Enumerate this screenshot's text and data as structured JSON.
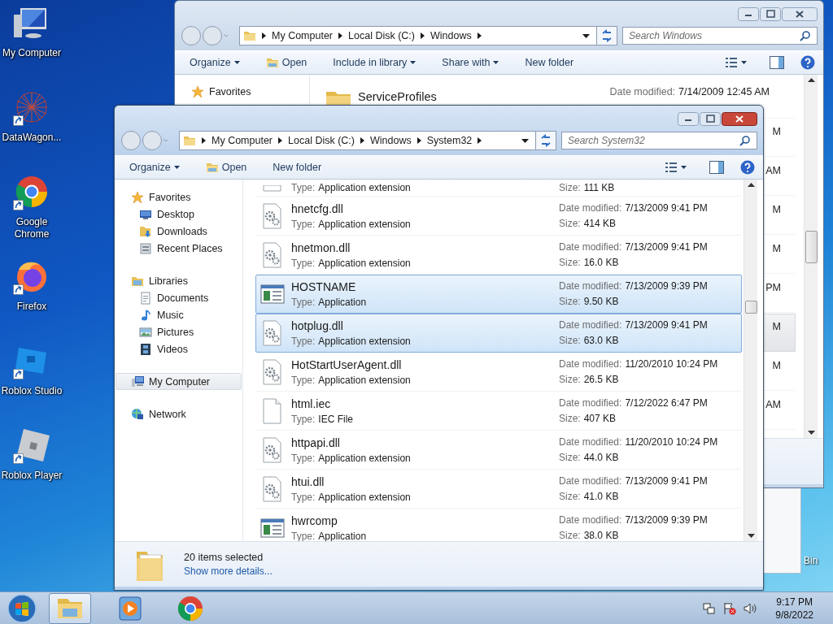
{
  "desktop_icons": [
    {
      "label": "My Computer",
      "kind": "computer",
      "shortcut": false
    },
    {
      "label": "DataWagon...",
      "kind": "web",
      "shortcut": true
    },
    {
      "label": "Google Chrome",
      "kind": "chrome",
      "shortcut": true
    },
    {
      "label": "Firefox",
      "kind": "firefox",
      "shortcut": true
    },
    {
      "label": "Roblox Studio",
      "kind": "studio",
      "shortcut": true
    },
    {
      "label": "Roblox Player",
      "kind": "player",
      "shortcut": true
    }
  ],
  "recycle_bin_label": "Bin",
  "back_window": {
    "address": [
      "My Computer",
      "Local Disk (C:)",
      "Windows"
    ],
    "search": {
      "placeholder": "Search Windows"
    },
    "toolbar": [
      {
        "label": "Organize",
        "kind": "menu"
      },
      {
        "label": "Open",
        "kind": "open"
      },
      {
        "label": "Include in library",
        "kind": "menu"
      },
      {
        "label": "Share with",
        "kind": "menu"
      },
      {
        "label": "New folder",
        "kind": "plain"
      }
    ],
    "sidebar": [
      {
        "label": "Favorites",
        "kind": "star"
      }
    ],
    "first_row": {
      "name": "ServiceProfiles",
      "date_label": "Date modified:",
      "date": "7/14/2009 12:45 AM"
    },
    "row_tails": [
      {
        "text": "M",
        "selected": false
      },
      {
        "text": "AM",
        "selected": false
      },
      {
        "text": "M",
        "selected": false
      },
      {
        "text": "M",
        "selected": false
      },
      {
        "text": "PM",
        "selected": false
      },
      {
        "text": "M",
        "selected": true
      },
      {
        "text": "M",
        "selected": false
      },
      {
        "text": "AM",
        "selected": false
      }
    ]
  },
  "front_window": {
    "address": [
      "My Computer",
      "Local Disk (C:)",
      "Windows",
      "System32"
    ],
    "search": {
      "placeholder": "Search System32"
    },
    "toolbar": [
      {
        "label": "Organize",
        "kind": "menu"
      },
      {
        "label": "Open",
        "kind": "open"
      },
      {
        "label": "New folder",
        "kind": "plain"
      }
    ],
    "sidebar": [
      {
        "label": "Favorites",
        "kind": "star",
        "selected": false,
        "children": [
          {
            "label": "Desktop",
            "kind": "desktop",
            "selected": false
          },
          {
            "label": "Downloads",
            "kind": "downloads",
            "selected": false
          },
          {
            "label": "Recent Places",
            "kind": "recent",
            "selected": false
          }
        ]
      },
      {
        "label": "Libraries",
        "kind": "libraries",
        "selected": false,
        "children": [
          {
            "label": "Documents",
            "kind": "documents",
            "selected": false
          },
          {
            "label": "Music",
            "kind": "music",
            "selected": false
          },
          {
            "label": "Pictures",
            "kind": "pictures",
            "selected": false
          },
          {
            "label": "Videos",
            "kind": "videos",
            "selected": false
          }
        ]
      },
      {
        "label": "My Computer",
        "kind": "computer",
        "selected": true
      },
      {
        "label": "Network",
        "kind": "network",
        "selected": false
      }
    ],
    "partial_row": {
      "type_label": "Type:",
      "type": "Application extension",
      "size_label": "Size:",
      "size": "111 KB"
    },
    "rows": [
      {
        "name": "hnetcfg.dll",
        "kind": "dll",
        "type_label": "Type:",
        "type": "Application extension",
        "date_label": "Date modified:",
        "date": "7/13/2009 9:41 PM",
        "size_label": "Size:",
        "size": "414 KB",
        "selected": false
      },
      {
        "name": "hnetmon.dll",
        "kind": "dll",
        "type_label": "Type:",
        "type": "Application extension",
        "date_label": "Date modified:",
        "date": "7/13/2009 9:41 PM",
        "size_label": "Size:",
        "size": "16.0 KB",
        "selected": false
      },
      {
        "name": "HOSTNAME",
        "kind": "app",
        "type_label": "Type:",
        "type": "Application",
        "date_label": "Date modified:",
        "date": "7/13/2009 9:39 PM",
        "size_label": "Size:",
        "size": "9.50 KB",
        "selected": true
      },
      {
        "name": "hotplug.dll",
        "kind": "dll",
        "type_label": "Type:",
        "type": "Application extension",
        "date_label": "Date modified:",
        "date": "7/13/2009 9:41 PM",
        "size_label": "Size:",
        "size": "63.0 KB",
        "selected": true
      },
      {
        "name": "HotStartUserAgent.dll",
        "kind": "dll",
        "type_label": "Type:",
        "type": "Application extension",
        "date_label": "Date modified:",
        "date": "11/20/2010 10:24 PM",
        "size_label": "Size:",
        "size": "26.5 KB",
        "selected": false
      },
      {
        "name": "html.iec",
        "kind": "file",
        "type_label": "Type:",
        "type": "IEC File",
        "date_label": "Date modified:",
        "date": "7/12/2022 6:47 PM",
        "size_label": "Size:",
        "size": "407 KB",
        "selected": false
      },
      {
        "name": "httpapi.dll",
        "kind": "dll",
        "type_label": "Type:",
        "type": "Application extension",
        "date_label": "Date modified:",
        "date": "11/20/2010 10:24 PM",
        "size_label": "Size:",
        "size": "44.0 KB",
        "selected": false
      },
      {
        "name": "htui.dll",
        "kind": "dll",
        "type_label": "Type:",
        "type": "Application extension",
        "date_label": "Date modified:",
        "date": "7/13/2009 9:41 PM",
        "size_label": "Size:",
        "size": "41.0 KB",
        "selected": false
      },
      {
        "name": "hwrcomp",
        "kind": "app",
        "type_label": "Type:",
        "type": "Application",
        "date_label": "Date modified:",
        "date": "7/13/2009 9:39 PM",
        "size_label": "Size:",
        "size": "38.0 KB",
        "selected": false
      }
    ],
    "details": {
      "summary": "20 items selected",
      "link": "Show more details..."
    }
  },
  "taskbar": {
    "apps": [
      {
        "kind": "explorer",
        "active": true
      },
      {
        "kind": "media",
        "active": false
      },
      {
        "kind": "chrome",
        "active": false
      }
    ],
    "time": "9:17 PM",
    "date": "9/8/2022"
  }
}
